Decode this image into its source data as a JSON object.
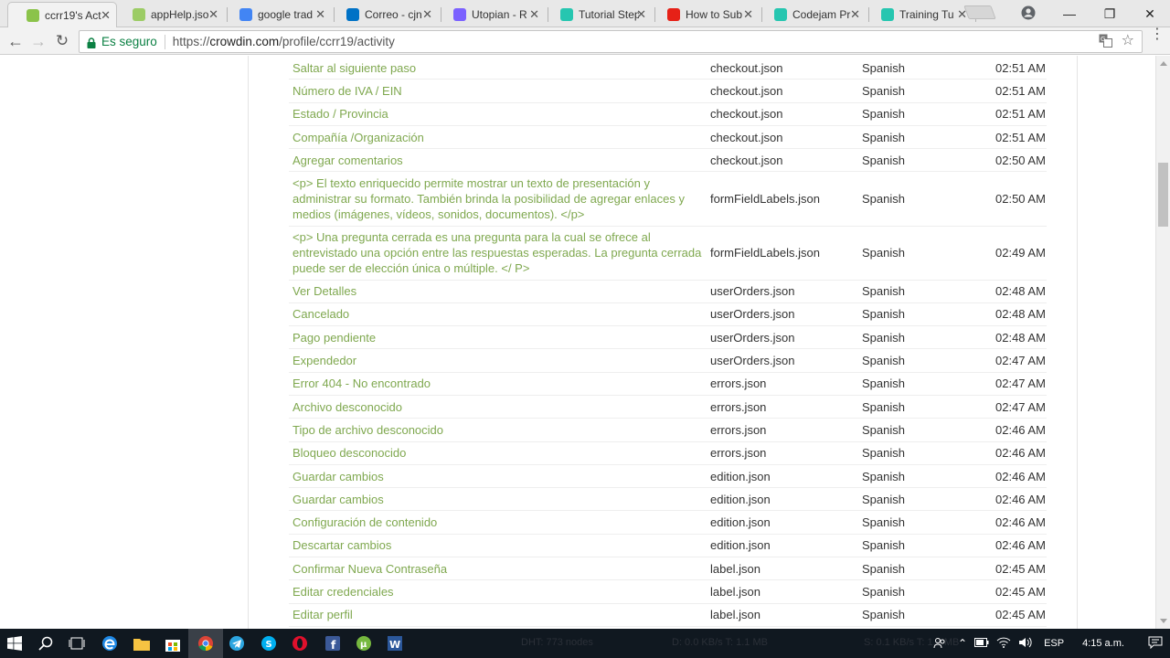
{
  "browser": {
    "tabs": [
      {
        "title": "ccrr19's Act",
        "color": "#8bc34a",
        "active": true
      },
      {
        "title": "appHelp.jso",
        "color": "#9ccc65",
        "active": false
      },
      {
        "title": "google trad",
        "color": "#4285f4",
        "active": false
      },
      {
        "title": "Correo - cjn",
        "color": "#0072c6",
        "active": false
      },
      {
        "title": "Utopian - R",
        "color": "#7b61ff",
        "active": false
      },
      {
        "title": "Tutorial Step",
        "color": "#26c6b0",
        "active": false
      },
      {
        "title": "How to Sub",
        "color": "#e62117",
        "active": false
      },
      {
        "title": "Codejam Pr",
        "color": "#26c6b0",
        "active": false
      },
      {
        "title": "Training Tu",
        "color": "#26c6b0",
        "active": false
      }
    ],
    "security_label": "Es seguro",
    "url_scheme": "https://",
    "url_host": "crowdin.com",
    "url_path": "/profile/ccrr19/activity"
  },
  "activity": {
    "rows": [
      {
        "text": "Saltar al siguiente paso",
        "file": "checkout.json",
        "language": "Spanish",
        "time": "02:51 AM"
      },
      {
        "text": "Número de IVA / EIN",
        "file": "checkout.json",
        "language": "Spanish",
        "time": "02:51 AM"
      },
      {
        "text": "Estado / Provincia",
        "file": "checkout.json",
        "language": "Spanish",
        "time": "02:51 AM"
      },
      {
        "text": "Compañía /Organización",
        "file": "checkout.json",
        "language": "Spanish",
        "time": "02:51 AM"
      },
      {
        "text": "Agregar comentarios",
        "file": "checkout.json",
        "language": "Spanish",
        "time": "02:50 AM"
      },
      {
        "text": "<p> El texto enriquecido permite mostrar un texto de presentación y administrar su formato. También brinda la posibilidad de agregar enlaces y medios (imágenes, vídeos, sonidos, documentos). </p>",
        "file": "formFieldLabels.json",
        "language": "Spanish",
        "time": "02:50 AM"
      },
      {
        "text": "<p> Una pregunta cerrada es una pregunta para la cual se ofrece al entrevistado una opción entre las respuestas esperadas. La pregunta cerrada puede ser de elección única o múltiple. </ P>",
        "file": "formFieldLabels.json",
        "language": "Spanish",
        "time": "02:49 AM"
      },
      {
        "text": "Ver Detalles",
        "file": "userOrders.json",
        "language": "Spanish",
        "time": "02:48 AM"
      },
      {
        "text": "Cancelado",
        "file": "userOrders.json",
        "language": "Spanish",
        "time": "02:48 AM"
      },
      {
        "text": "Pago pendiente",
        "file": "userOrders.json",
        "language": "Spanish",
        "time": "02:48 AM"
      },
      {
        "text": "Expendedor",
        "file": "userOrders.json",
        "language": "Spanish",
        "time": "02:47 AM"
      },
      {
        "text": "Error 404 - No encontrado",
        "file": "errors.json",
        "language": "Spanish",
        "time": "02:47 AM"
      },
      {
        "text": "Archivo desconocido",
        "file": "errors.json",
        "language": "Spanish",
        "time": "02:47 AM"
      },
      {
        "text": "Tipo de archivo desconocido",
        "file": "errors.json",
        "language": "Spanish",
        "time": "02:46 AM"
      },
      {
        "text": "Bloqueo desconocido",
        "file": "errors.json",
        "language": "Spanish",
        "time": "02:46 AM"
      },
      {
        "text": "Guardar cambios",
        "file": "edition.json",
        "language": "Spanish",
        "time": "02:46 AM"
      },
      {
        "text": "Guardar cambios",
        "file": "edition.json",
        "language": "Spanish",
        "time": "02:46 AM"
      },
      {
        "text": "Configuración de contenido",
        "file": "edition.json",
        "language": "Spanish",
        "time": "02:46 AM"
      },
      {
        "text": "Descartar cambios",
        "file": "edition.json",
        "language": "Spanish",
        "time": "02:46 AM"
      },
      {
        "text": "Confirmar Nueva Contraseña",
        "file": "label.json",
        "language": "Spanish",
        "time": "02:45 AM"
      },
      {
        "text": "Editar credenciales",
        "file": "label.json",
        "language": "Spanish",
        "time": "02:45 AM"
      },
      {
        "text": "Editar perfil",
        "file": "label.json",
        "language": "Spanish",
        "time": "02:45 AM"
      }
    ]
  },
  "taskbar": {
    "dht_status": "DHT: 773 nodes",
    "download_status": "D: 0.0 KB/s T: 1.1 MB",
    "upload_status": "S: 0.1 KB/s T: 1.4 MB",
    "language": "ESP",
    "clock": "4:15 a.m."
  },
  "colors": {
    "link_green": "#7fa84f",
    "secure_green": "#0b8043",
    "taskbar_bg": "#101820"
  }
}
